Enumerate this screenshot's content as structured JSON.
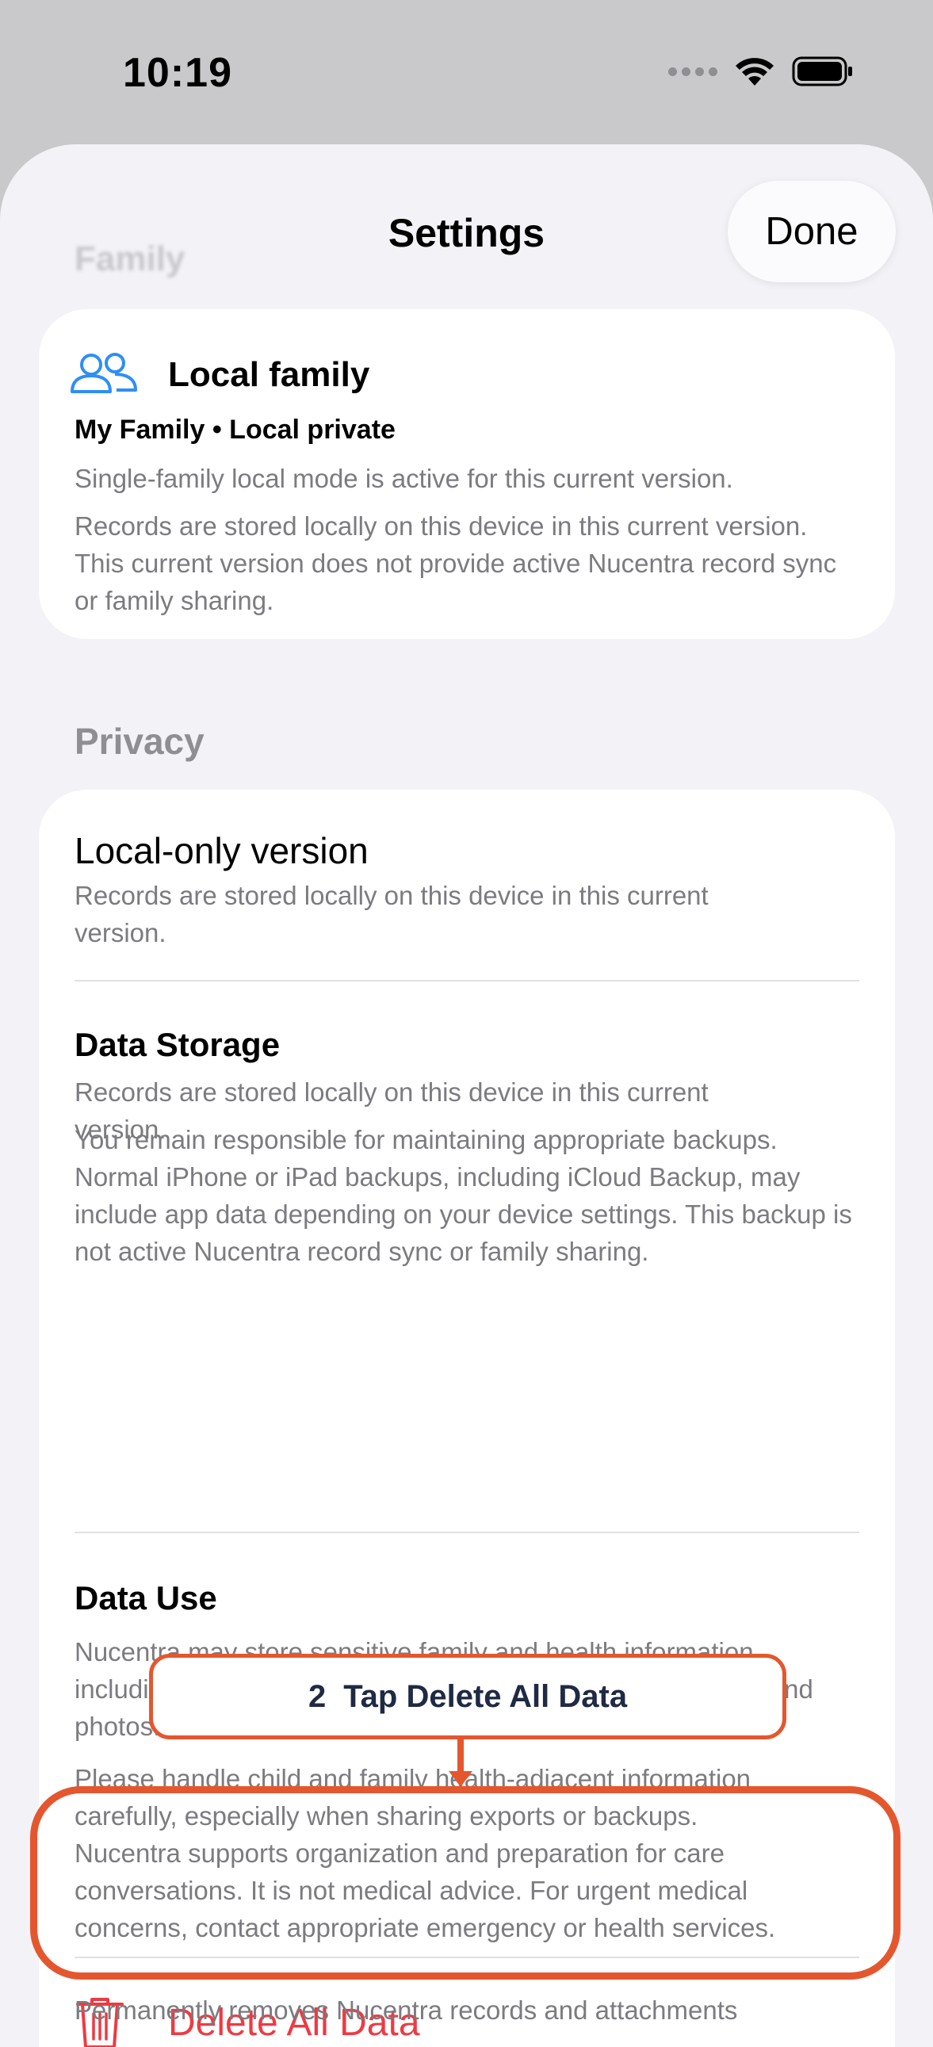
{
  "status_bar": {
    "time": "10:19"
  },
  "header": {
    "ghost_section": "Family",
    "title": "Settings",
    "done_label": "Done"
  },
  "family_card": {
    "title": "Local family",
    "subtitle": "My Family • Local private",
    "line1": "Single-family local mode is active for this current version.",
    "line2": "Records are stored locally on this device in this current version. This current version does not provide active Nucentra record sync or family sharing.",
    "icon": "people-icon",
    "accent": "#2f8ef6"
  },
  "privacy": {
    "section_label": "Privacy",
    "local_only": {
      "title": "Local-only version",
      "text": "Records are stored locally on this device in this current version."
    },
    "data_storage": {
      "title": "Data Storage",
      "text1": "Records are stored locally on this device in this current version.",
      "text2": "You remain responsible for maintaining appropriate backups. Normal iPhone or iPad backups, including iCloud Backup, may include app data depending on your device settings. This backup is not active Nucentra record sync or family sharing."
    },
    "data_use": {
      "title": "Data Use",
      "text1": "Nucentra may store sensitive family and health information, including profile details, health records, notes, attachments, and photos.",
      "text2": "Please handle child and family health-adjacent information carefully, especially when sharing exports or backups.",
      "text3": "Nucentra supports organization and preparation for care conversations. It is not medical advice. For urgent medical concerns, contact appropriate emergency or health services."
    },
    "delete_all": {
      "label": "Delete All Data",
      "icon": "trash-icon",
      "color": "#ee3a43"
    },
    "below_text": "Permanently removes Nucentra records and attachments"
  },
  "overlay": {
    "step_number": "2",
    "step_text": "Tap Delete All Data",
    "highlight_color": "#e4572e"
  }
}
